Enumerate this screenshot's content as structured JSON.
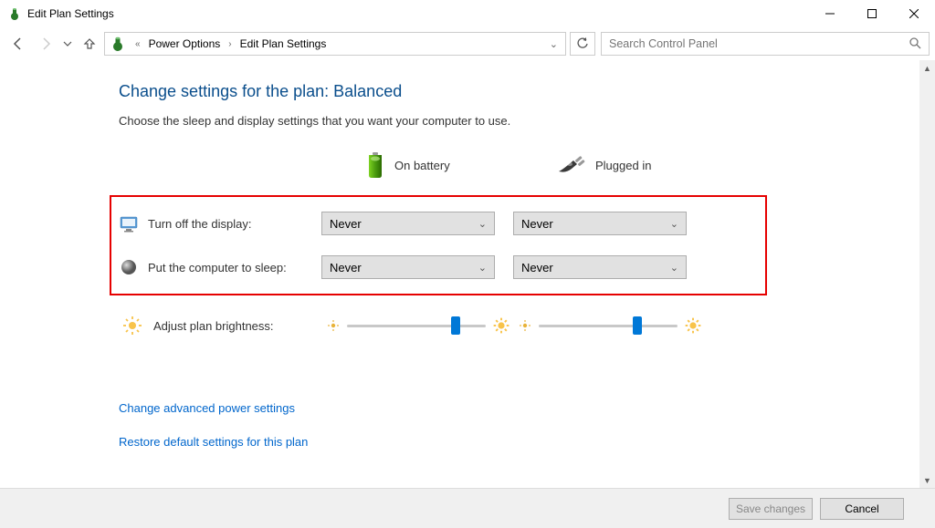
{
  "window": {
    "title": "Edit Plan Settings"
  },
  "breadcrumb": {
    "part1": "Power Options",
    "part2": "Edit Plan Settings"
  },
  "search": {
    "placeholder": "Search Control Panel"
  },
  "page": {
    "heading": "Change settings for the plan: Balanced",
    "sub": "Choose the sleep and display settings that you want your computer to use."
  },
  "columns": {
    "battery": "On battery",
    "plugged": "Plugged in"
  },
  "rows": {
    "display": {
      "label": "Turn off the display:",
      "battery": "Never",
      "plugged": "Never"
    },
    "sleep": {
      "label": "Put the computer to sleep:",
      "battery": "Never",
      "plugged": "Never"
    },
    "brightness": {
      "label": "Adjust plan brightness:"
    }
  },
  "links": {
    "advanced": "Change advanced power settings",
    "restore": "Restore default settings for this plan"
  },
  "buttons": {
    "save": "Save changes",
    "cancel": "Cancel"
  }
}
